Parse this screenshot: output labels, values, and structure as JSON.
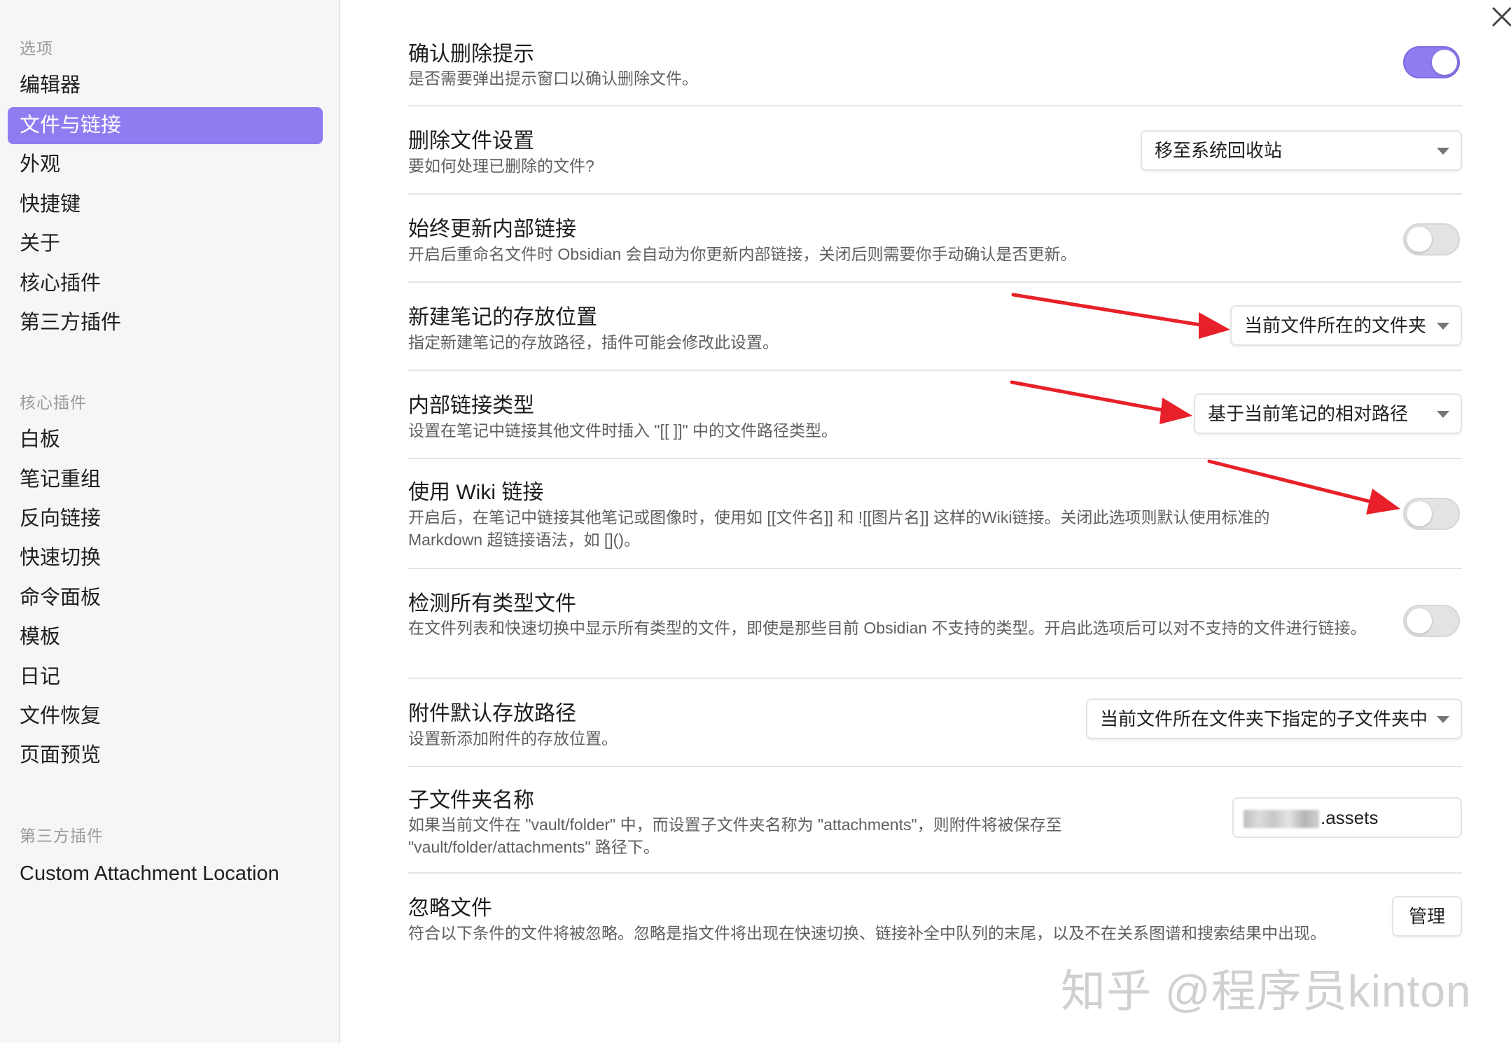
{
  "sidebar": {
    "section_options": "选项",
    "options_items": [
      "编辑器",
      "文件与链接",
      "外观",
      "快捷键",
      "关于",
      "核心插件",
      "第三方插件"
    ],
    "active_item": "文件与链接",
    "section_core": "核心插件",
    "core_items": [
      "白板",
      "笔记重组",
      "反向链接",
      "快速切换",
      "命令面板",
      "模板",
      "日记",
      "文件恢复",
      "页面预览"
    ],
    "section_third": "第三方插件",
    "third_items": [
      "Custom Attachment Location"
    ]
  },
  "settings": [
    {
      "title": "确认删除提示",
      "desc": "是否需要弹出提示窗口以确认删除文件。",
      "control": "toggle",
      "on": true
    },
    {
      "title": "删除文件设置",
      "desc": "要如何处理已删除的文件?",
      "control": "dropdown",
      "value": "移至系统回收站"
    },
    {
      "title": "始终更新内部链接",
      "desc": "开启后重命名文件时 Obsidian 会自动为你更新内部链接，关闭后则需要你手动确认是否更新。",
      "control": "toggle",
      "on": false
    },
    {
      "title": "新建笔记的存放位置",
      "desc": "指定新建笔记的存放路径，插件可能会修改此设置。",
      "control": "dropdown",
      "value": "当前文件所在的文件夹"
    },
    {
      "title": "内部链接类型",
      "desc": "设置在笔记中链接其他文件时插入 \"[[ ]]\" 中的文件路径类型。",
      "control": "dropdown",
      "value": "基于当前笔记的相对路径"
    },
    {
      "title": "使用 Wiki 链接",
      "desc": "开启后，在笔记中链接其他笔记或图像时，使用如 [[文件名]] 和 ![[图片名]] 这样的Wiki链接。关闭此选项则默认使用标准的 Markdown 超链接语法，如 []()。",
      "control": "toggle",
      "on": false
    },
    {
      "title": "检测所有类型文件",
      "desc": "在文件列表和快速切换中显示所有类型的文件，即使是那些目前 Obsidian 不支持的类型。开启此选项后可以对不支持的文件进行链接。",
      "control": "toggle",
      "on": false
    },
    {
      "title": "附件默认存放路径",
      "desc": "设置新添加附件的存放位置。",
      "control": "dropdown",
      "value": "当前文件所在文件夹下指定的子文件夹中"
    },
    {
      "title": "子文件夹名称",
      "desc": "如果当前文件在 \"vault/folder\" 中，而设置子文件夹名称为 \"attachments\"，则附件将被保存至 \"vault/folder/attachments\" 路径下。",
      "control": "text",
      "value": ".assets"
    },
    {
      "title": "忽略文件",
      "desc": "符合以下条件的文件将被忽略。忽略是指文件将出现在快速切换、链接补全中队列的末尾，以及不在关系图谱和搜索结果中出现。",
      "control": "button",
      "value": "管理"
    }
  ],
  "watermark": "知乎 @程序员kinton",
  "colors": {
    "accent": "#8f7cf1",
    "arrow": "#e8202a"
  }
}
